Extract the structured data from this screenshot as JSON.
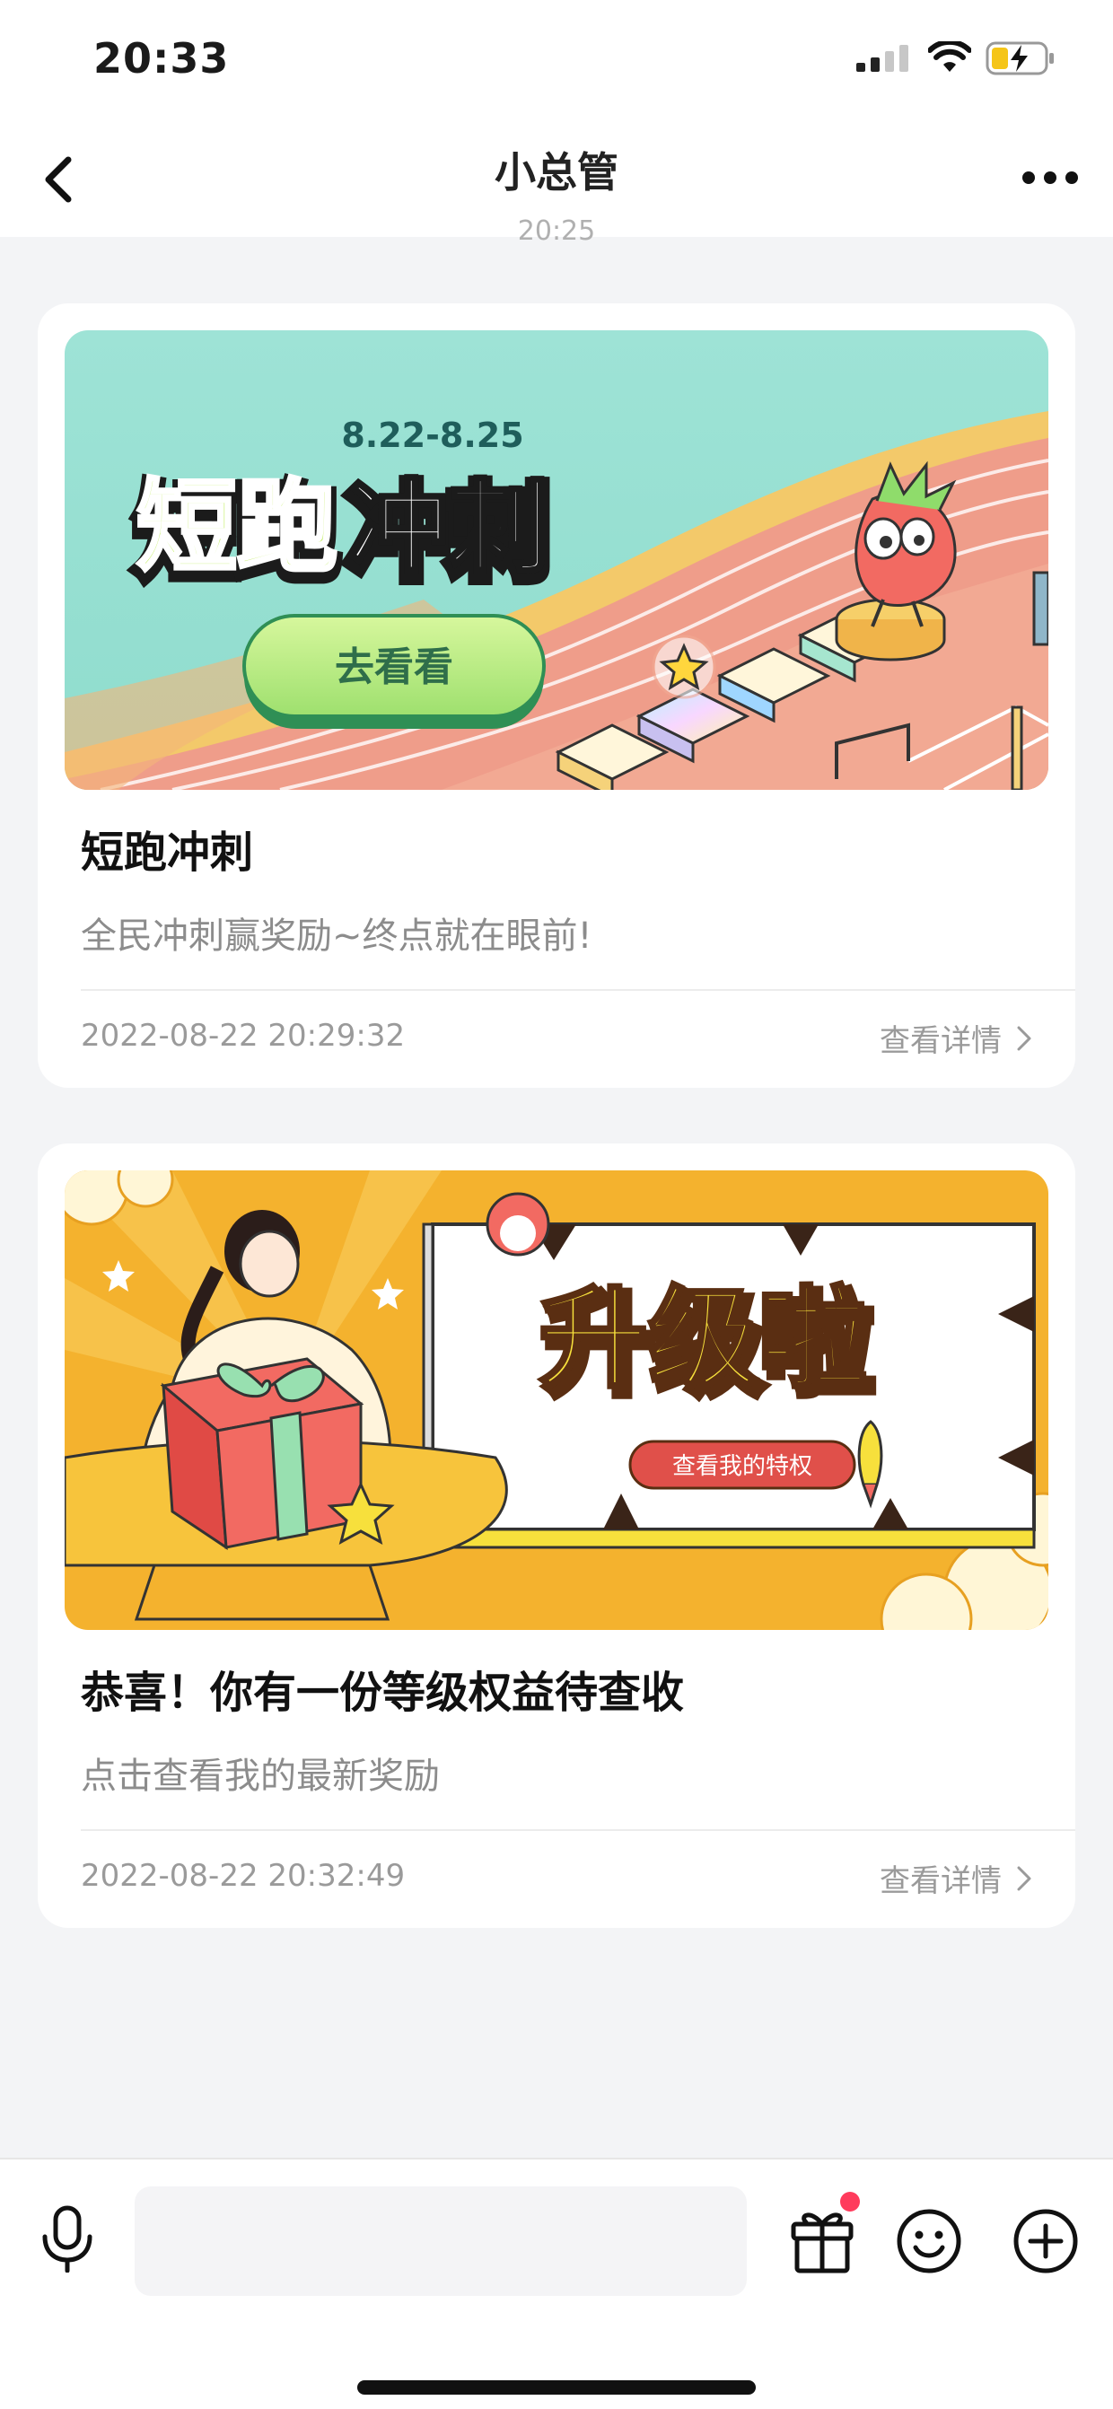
{
  "status_bar": {
    "time": "20:33",
    "icons": [
      "signal-icon",
      "wifi-icon",
      "battery-charging-icon"
    ]
  },
  "nav": {
    "title": "小总管",
    "back_icon": "chevron-left-icon",
    "more_icon": "more-horizontal-icon"
  },
  "partial_timestamp": "20:25",
  "messages": [
    {
      "banner": {
        "date_range": "8.22-8.25",
        "headline_1": "短跑",
        "headline_2": "冲刺",
        "button_label": "去看看",
        "colors": {
          "sky": "#9ee3d6",
          "track": "#f0a08e",
          "headline_green": "#c6ef6b",
          "button": "#a9e27a"
        }
      },
      "title": "短跑冲刺",
      "subtitle": "全民冲刺赢奖励~终点就在眼前!",
      "timestamp": "2022-08-22 20:29:32",
      "link_label": "查看详情"
    },
    {
      "banner": {
        "headline": "升级啦",
        "button_label": "查看我的特权",
        "colors": {
          "background": "#f4b22e",
          "headline_yellow": "#f7e03c",
          "button_red": "#e0504a"
        }
      },
      "title": "恭喜！你有一份等级权益待查收",
      "subtitle": "点击查看我的最新奖励",
      "timestamp": "2022-08-22 20:32:49",
      "link_label": "查看详情"
    }
  ],
  "input_bar": {
    "input_value": "",
    "icons": [
      "microphone-icon",
      "gift-icon",
      "emoji-icon",
      "plus-circle-icon"
    ],
    "gift_badge_color": "#ff3b5c"
  }
}
